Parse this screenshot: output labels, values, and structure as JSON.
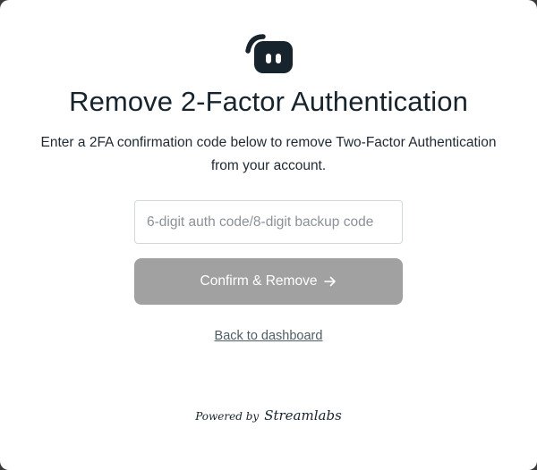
{
  "title": "Remove 2-Factor Authentication",
  "description": "Enter a 2FA confirmation code below to remove Two-Factor Authentication from your account.",
  "code_input": {
    "placeholder": "6-digit auth code/8-digit backup code",
    "value": ""
  },
  "confirm_button": {
    "label": "Confirm & Remove",
    "icon": "arrow-right-icon"
  },
  "back_link": "Back to dashboard",
  "footer": {
    "powered_by": "Powered by",
    "brand": "Streamlabs"
  },
  "logo": {
    "icon": "streamlabs-logo-icon",
    "color": "#17242d"
  },
  "colors": {
    "title": "#17242d",
    "button_disabled": "#a1a1a1",
    "input_border": "#d4d8db",
    "link": "#4f5d66"
  }
}
